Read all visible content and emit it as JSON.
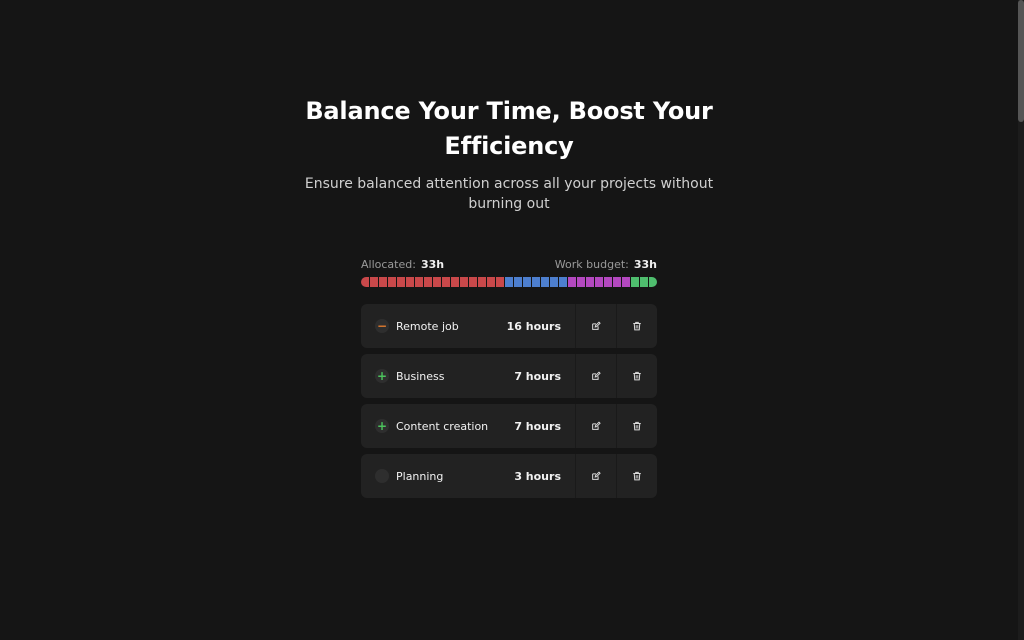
{
  "hero": {
    "title": "Balance Your Time, Boost Your Efficiency",
    "subtitle": "Ensure balanced attention across all your projects without burning out"
  },
  "budget": {
    "allocated_label": "Allocated:",
    "allocated_value": "33h",
    "work_budget_label": "Work budget:",
    "work_budget_value": "33h",
    "segments": [
      {
        "project": "Remote job",
        "count": 16,
        "color": "#c9484a"
      },
      {
        "project": "Business",
        "count": 7,
        "color": "#4d7fcf"
      },
      {
        "project": "Content creation",
        "count": 7,
        "color": "#b448c0"
      },
      {
        "project": "Planning",
        "count": 3,
        "color": "#4fbe6e"
      }
    ]
  },
  "projects": [
    {
      "name": "Remote job",
      "hours": "16 hours",
      "status": "minus",
      "status_glyph": "−",
      "status_icon": "minus-icon"
    },
    {
      "name": "Business",
      "hours": "7 hours",
      "status": "plus",
      "status_glyph": "+",
      "status_icon": "plus-icon"
    },
    {
      "name": "Content creation",
      "hours": "7 hours",
      "status": "plus",
      "status_glyph": "+",
      "status_icon": "plus-icon"
    },
    {
      "name": "Planning",
      "hours": "3 hours",
      "status": "none",
      "status_glyph": "",
      "status_icon": "empty-status-icon"
    }
  ],
  "colors": {
    "background": "#151515",
    "card": "#222222",
    "minus": "#e07a2e",
    "plus": "#4cc35d"
  }
}
